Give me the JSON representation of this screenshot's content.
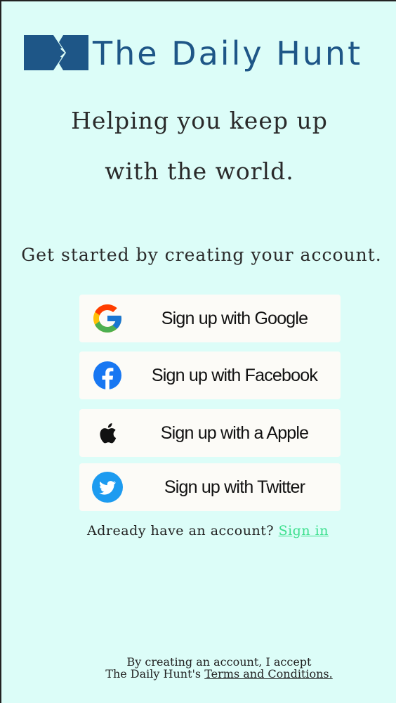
{
  "app": {
    "brand_name": "The Daily Hunt"
  },
  "hero": {
    "tagline_line1": "Helping you keep up",
    "tagline_line2": "with the world.",
    "get_started": "Get started by creating your account."
  },
  "signup_options": [
    {
      "label": "Sign up with Google",
      "icon": "google-icon"
    },
    {
      "label": "Sign up with Facebook",
      "icon": "facebook-icon"
    },
    {
      "label": "Sign up with a Apple",
      "icon": "apple-icon"
    },
    {
      "label": "Sign up with Twitter",
      "icon": "twitter-icon"
    }
  ],
  "signin": {
    "prompt": "Adready have an account?",
    "link_label": "Sign in"
  },
  "terms": {
    "line1": "By creating an account, I accept",
    "line2_prefix": "The Daily Hunt's",
    "link_label": "Terms and Conditions."
  },
  "colors": {
    "background": "#dcfdf8",
    "brand": "#1e5687",
    "button_bg": "#fcfbf7",
    "signin_link": "#3ee08f",
    "facebook": "#1877f2",
    "twitter": "#1d9bf0"
  }
}
